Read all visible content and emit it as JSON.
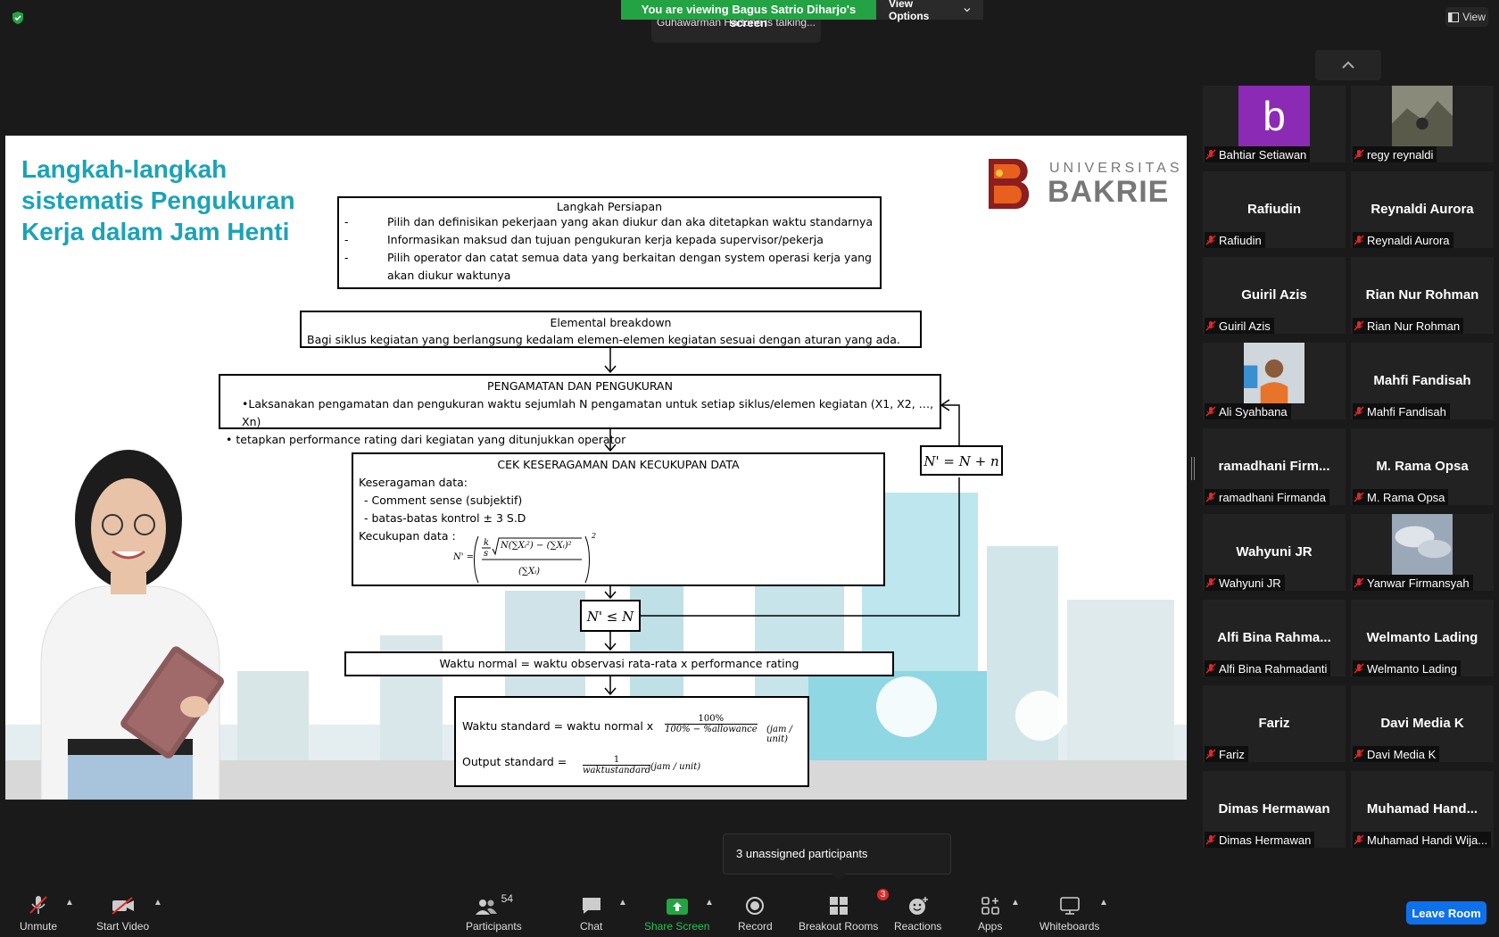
{
  "meeting": {
    "share_banner": "You are viewing Bagus Satrio Diharjo's screen",
    "view_options": "View Options",
    "talking": "Guhawarman Hartono is talking...",
    "view_label": "View"
  },
  "slide": {
    "title": "Langkah-langkah sistematis Pengukuran Kerja dalam Jam Henti",
    "logo_line1": "UNIVERSITAS",
    "logo_line2": "BAKRIE",
    "box1": {
      "title": "Langkah Persiapan",
      "items": [
        {
          "dash": "-",
          "text": "Pilih dan definisikan pekerjaan yang akan diukur dan aka ditetapkan waktu standarnya"
        },
        {
          "dash": "-",
          "text": "Informasikan maksud dan tujuan pengukuran kerja kepada supervisor/pekerja"
        },
        {
          "dash": "-",
          "text": "Pilih operator dan catat semua data yang berkaitan dengan system operasi kerja yang akan diukur waktunya"
        }
      ]
    },
    "box2": {
      "title": "Elemental breakdown",
      "text": "Bagi siklus kegiatan yang berlangsung kedalam elemen-elemen kegiatan sesuai dengan aturan yang ada."
    },
    "box3": {
      "title": "PENGAMATAN DAN PENGUKURAN",
      "line1": "•Laksanakan pengamatan dan pengukuran waktu sejumlah N pengamatan untuk setiap siklus/elemen kegiatan (X1, X2, …, Xn)",
      "line2": "• tetapkan performance rating dari kegiatan yang ditunjukkan operator"
    },
    "box4": {
      "title": "CEK KESERAGAMAN DAN KECUKUPAN DATA",
      "line1": "Keseragaman data:",
      "line2": "- Comment sense (subjektif)",
      "line3": "- batas-batas kontrol ± 3 S.D",
      "line4": "Kecukupan data :"
    },
    "formula_nprime": "N' = N + n",
    "formula_compare": "N' ≤ N",
    "box7": "Waktu normal = waktu observasi rata-rata x performance rating",
    "box8": {
      "line1": "Waktu standard = waktu normal x",
      "frac1_num": "100%",
      "frac1_den": "100% − %allowance",
      "unit": "(jam / unit)",
      "line2": "Output standard =",
      "frac2_num": "1",
      "frac2_den": "waktustandard"
    }
  },
  "participants": [
    {
      "big": "",
      "label": "Bahtiar Setiawan",
      "photo": "avatar-b"
    },
    {
      "big": "",
      "label": "regy reynaldi",
      "photo": "photo"
    },
    {
      "big": "Rafiudin",
      "label": "Rafiudin"
    },
    {
      "big": "Reynaldi Aurora",
      "label": "Reynaldi Aurora"
    },
    {
      "big": "Guiril Azis",
      "label": "Guiril Azis"
    },
    {
      "big": "Rian Nur Rohman",
      "label": "Rian Nur Rohman"
    },
    {
      "big": "",
      "label": "Ali Syahbana",
      "photo": "photo"
    },
    {
      "big": "Mahfi Fandisah",
      "label": "Mahfi Fandisah"
    },
    {
      "big": "ramadhani  Firm...",
      "label": "ramadhani Firmanda"
    },
    {
      "big": "M. Rama Opsa",
      "label": "M. Rama Opsa"
    },
    {
      "big": "Wahyuni JR",
      "label": "Wahyuni JR"
    },
    {
      "big": "",
      "label": "Yanwar Firmansyah",
      "photo": "photo"
    },
    {
      "big": "Alfi Bina Rahma...",
      "label": "Alfi Bina Rahmadanti"
    },
    {
      "big": "Welmanto Lading",
      "label": "Welmanto Lading"
    },
    {
      "big": "Fariz",
      "label": "Fariz"
    },
    {
      "big": "Davi Media K",
      "label": "Davi Media K"
    },
    {
      "big": "Dimas Hermawan",
      "label": "Dimas Hermawan"
    },
    {
      "big": "Muhamad  Hand...",
      "label": "Muhamad Handi Wija..."
    }
  ],
  "avatar_letter": "b",
  "popup": "3 unassigned participants",
  "toolbar": {
    "unmute": "Unmute",
    "start_video": "Start Video",
    "participants": "Participants",
    "participants_count": "54",
    "chat": "Chat",
    "share_screen": "Share Screen",
    "record": "Record",
    "breakout_rooms": "Breakout Rooms",
    "breakout_badge": "3",
    "reactions": "Reactions",
    "apps": "Apps",
    "whiteboards": "Whiteboards",
    "leave_room": "Leave Room"
  },
  "colors": {
    "share_green": "#23a343",
    "leave_blue": "#0e71eb",
    "title_teal": "#1ba3b5",
    "logo_orange": "#e8601e",
    "muted_red": "#e02828"
  }
}
